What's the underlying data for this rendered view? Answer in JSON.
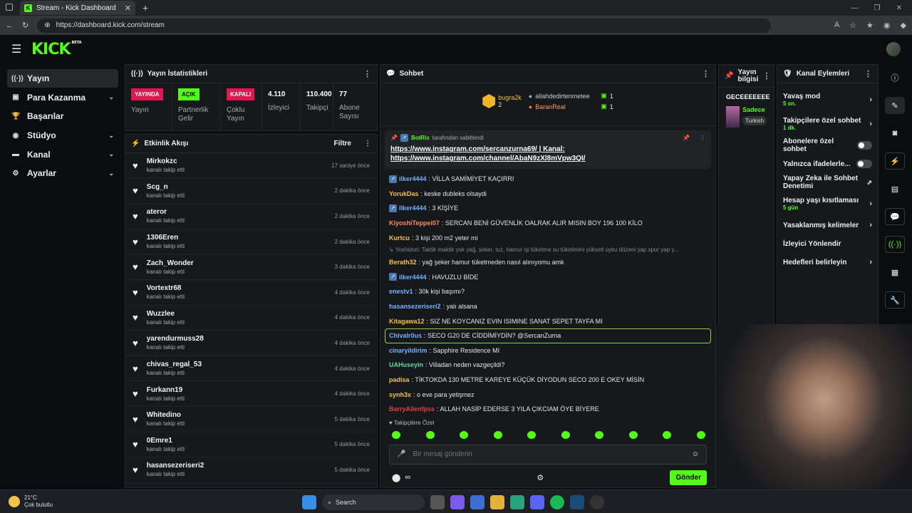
{
  "browser": {
    "tab_title": "Stream - Kick Dashboard",
    "url": "https://dashboard.kick.com/stream"
  },
  "brand": {
    "logo": "KICK",
    "beta": "BETA",
    "accent": "#53fc18"
  },
  "sidebar": {
    "items": [
      {
        "label": "Yayın",
        "icon": "broadcast-icon",
        "active": true,
        "chevron": false
      },
      {
        "label": "Para Kazanma",
        "icon": "money-icon",
        "active": false,
        "chevron": true
      },
      {
        "label": "Başarılar",
        "icon": "trophy-icon",
        "active": false,
        "chevron": false
      },
      {
        "label": "Stüdyo",
        "icon": "studio-icon",
        "active": false,
        "chevron": true
      },
      {
        "label": "Kanal",
        "icon": "channel-icon",
        "active": false,
        "chevron": true
      },
      {
        "label": "Ayarlar",
        "icon": "gear-icon",
        "active": false,
        "chevron": true
      }
    ]
  },
  "stats": {
    "title": "Yayın İstatistikleri",
    "cells": [
      {
        "badge": "YAYINDA",
        "label": "Yayın"
      },
      {
        "badge": "AÇIK",
        "label": "Partnerlik Gelir"
      },
      {
        "badge": "KAPALI",
        "label": "Çoklu Yayın"
      },
      {
        "value": "4.110",
        "label": "İzleyici"
      },
      {
        "value": "110.400",
        "label": "Takipçi"
      },
      {
        "value": "77",
        "label": "Abone Sayısı"
      }
    ]
  },
  "activity": {
    "title": "Etkinlik Akışı",
    "filter": "Filtre",
    "items": [
      {
        "name": "Mirkokzc",
        "sub": "kanalı takip etti",
        "time": "17 saniye önce"
      },
      {
        "name": "Scg_n",
        "sub": "kanalı takip etti",
        "time": "2 dakika önce"
      },
      {
        "name": "ateror",
        "sub": "kanalı takip etti",
        "time": "2 dakika önce"
      },
      {
        "name": "1306Eren",
        "sub": "kanalı takip etti",
        "time": "2 dakika önce"
      },
      {
        "name": "Zach_Wonder",
        "sub": "kanalı takip etti",
        "time": "3 dakika önce"
      },
      {
        "name": "Vortextr68",
        "sub": "kanalı takip etti",
        "time": "4 dakika önce"
      },
      {
        "name": "Wuzzlee",
        "sub": "kanalı takip etti",
        "time": "4 dakika önce"
      },
      {
        "name": "yarendurmuss28",
        "sub": "kanalı takip etti",
        "time": "4 dakika önce"
      },
      {
        "name": "chivas_regal_53",
        "sub": "kanalı takip etti",
        "time": "4 dakika önce"
      },
      {
        "name": "Furkann19",
        "sub": "kanalı takip etti",
        "time": "4 dakika önce"
      },
      {
        "name": "Whitedino",
        "sub": "kanalı takip etti",
        "time": "5 dakika önce"
      },
      {
        "name": "0Emre1",
        "sub": "kanalı takip etti",
        "time": "5 dakika önce"
      },
      {
        "name": "hasansezeriseri2",
        "sub": "kanalı takip etti",
        "time": "5 dakika önce"
      }
    ]
  },
  "chat": {
    "title": "Sohbet",
    "gifters": [
      {
        "name": "bugra2k",
        "count": "2"
      },
      {
        "name": "allahdedirtenmetee",
        "count": "1"
      },
      {
        "name": "BaranReal",
        "count": "1"
      }
    ],
    "pinned": {
      "user": "BotRix",
      "note": "tarafından sabitlendi",
      "line1": "https://www.instagram.com/sercanzurna69/ | Kanal:",
      "line2": "https://www.instagram.com/channel/AbaN9zXl8mVpw3QI/"
    },
    "messages": [
      {
        "user": "ilker4444",
        "color": "#6fb3ff",
        "text": ": VİLLA SAMİMİYET KAÇIRRI",
        "badge": true
      },
      {
        "user": "YorukDas",
        "color": "#f0c040",
        "text": ": keske dubleks olsaydi"
      },
      {
        "user": "ilker4444",
        "color": "#6fb3ff",
        "text": ": 3 KİŞİYE",
        "badge": true
      },
      {
        "user": "KiyoshiTeppei07",
        "color": "#ff8a5c",
        "text": ": SERCAN BENİ GÜVENLİK OALRAK ALIR MISIN BOY 196 100 KİLO"
      },
      {
        "user": "Kurtcu",
        "color": "#f0c040",
        "text": ": 3 kişi 200 m2 yeter mi"
      },
      {
        "reply": "↳ Yoshidori: Taktik maktik yok yağ, şeker, tuz, hamur işi tüketme su tüketimini yükselt uyku düzeni yap spor yap y..."
      },
      {
        "user": "Berath32",
        "color": "#f0c040",
        "text": ": yağ şeker hamur tüketmeden nasıl alınıyomu amk"
      },
      {
        "user": "ilker4444",
        "color": "#6fb3ff",
        "text": ": HAVUZLU BİDE",
        "badge": true
      },
      {
        "user": "enestv1",
        "color": "#6fb3ff",
        "text": ": 30k kişi başımı?"
      },
      {
        "user": "hasansezeriseri2",
        "color": "#6fb3ff",
        "text": ": yalı alsana"
      },
      {
        "user": "Kitagawa12",
        "color": "#f0c040",
        "text": ": SIZ NE KOYCANIZ EVIN ISIMINE SANAT SEPET TAYFA MI"
      },
      {
        "user": "Chivalr0us",
        "color": "#6fb3ff",
        "text": ": SECO G20 DE CİDDİMİYDİN? @SercanZurna",
        "highlight": true
      },
      {
        "user": "cinaryildirim",
        "color": "#6fb3ff",
        "text": ": Sapphire Residence MI"
      },
      {
        "user": "UAHuseyin",
        "color": "#5cd6a0",
        "text": ": Villadan neden vazgeçildi?"
      },
      {
        "user": "padisa",
        "color": "#f0c040",
        "text": ": TİKTOKDA 130 METRE KAREYE KÜÇÜK DİYODUN SECO 200 E OKEY MİSİN"
      },
      {
        "user": "synh3x",
        "color": "#f0c040",
        "text": ": o eve para yetişmez"
      },
      {
        "user": "BarryAllenfpss",
        "color": "#e04040",
        "text": ": ALLAH NASİP EDERSE 3 YILA ÇIKCIAM ÖYE BİYERE"
      }
    ],
    "followers_only": "Takipçilere Özel",
    "input_placeholder": "Bir mesaj gönderin",
    "send": "Gönder"
  },
  "stream_info": {
    "title": "Yayın bilgisi",
    "stream_title": "GECEEEEEEE",
    "category": "Sadece",
    "tag": "Turkish"
  },
  "channel_actions": {
    "title": "Kanal Eylemleri",
    "items": [
      {
        "label": "Yavaş mod",
        "sub": "5 sn.",
        "type": "arrow"
      },
      {
        "label": "Takipçilere özel sohbet",
        "sub": "1 dk.",
        "type": "arrow"
      },
      {
        "label": "Abonelere özel sohbet",
        "type": "toggle"
      },
      {
        "label": "Yalnızca ifadelerle...",
        "type": "toggle"
      },
      {
        "label": "Yapay Zeka ile Sohbet Denetimi",
        "type": "external"
      },
      {
        "label": "Hesap yaşı kısıtlaması",
        "sub": "5 gün",
        "type": "arrow"
      },
      {
        "label": "Yasaklanmış kelimeler",
        "type": "arrow"
      },
      {
        "label": "İzleyici Yönlendir",
        "type": "none"
      },
      {
        "label": "Hedefleri belirleyin",
        "type": "arrow"
      }
    ]
  },
  "taskbar": {
    "temp": "21°C",
    "weather": "Çok bulutlu",
    "search": "Search"
  }
}
